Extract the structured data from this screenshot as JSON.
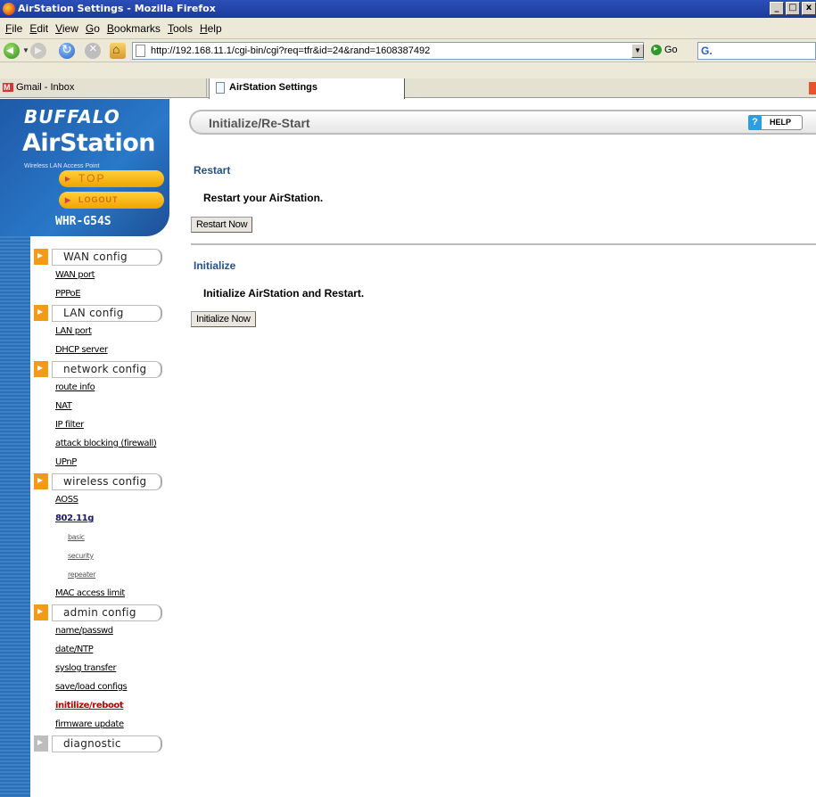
{
  "window": {
    "title": "AirStation Settings - Mozilla Firefox",
    "controls": [
      "_",
      "□",
      "x"
    ]
  },
  "menubar": {
    "items": [
      "File",
      "Edit",
      "View",
      "Go",
      "Bookmarks",
      "Tools",
      "Help"
    ]
  },
  "navbar": {
    "url": "http://192.168.11.1/cgi-bin/cgi?req=tfr&id=24&rand=1608387492",
    "go_label": "Go"
  },
  "tabs": [
    {
      "label": "Gmail - Inbox"
    },
    {
      "label": "AirStation Settings"
    }
  ],
  "sidebar": {
    "brand": "BUFFALO",
    "product": "AirStation",
    "tagline": "Wireless LAN Access Point",
    "top_label": "TOP",
    "logout_label": "LOGOUT",
    "model": "WHR-G54S",
    "sections": [
      {
        "label": "WAN config",
        "links": [
          "WAN port",
          "PPPoE"
        ]
      },
      {
        "label": "LAN config",
        "links": [
          "LAN port",
          "DHCP server"
        ]
      },
      {
        "label": "network config",
        "links": [
          "route info",
          "NAT",
          "IP filter",
          "attack blocking (firewall)",
          "UPnP"
        ]
      },
      {
        "label": "wireless config",
        "links": [
          "AOSS",
          "802.11g",
          "basic",
          "security",
          "repeater",
          "MAC access limit"
        ]
      },
      {
        "label": "admin config",
        "links": [
          "name/passwd",
          "date/NTP",
          "syslog transfer",
          "save/load configs",
          "initilize/reboot",
          "firmware update"
        ]
      },
      {
        "label": "diagnostic",
        "links": []
      }
    ]
  },
  "content": {
    "title": "Initialize/Re-Start",
    "help_label": "HELP",
    "restart": {
      "heading": "Restart",
      "text": "Restart your AirStation.",
      "button": "Restart Now"
    },
    "initialize": {
      "heading": "Initialize",
      "text": "Initialize AirStation and Restart.",
      "button": "Initialize Now"
    }
  }
}
